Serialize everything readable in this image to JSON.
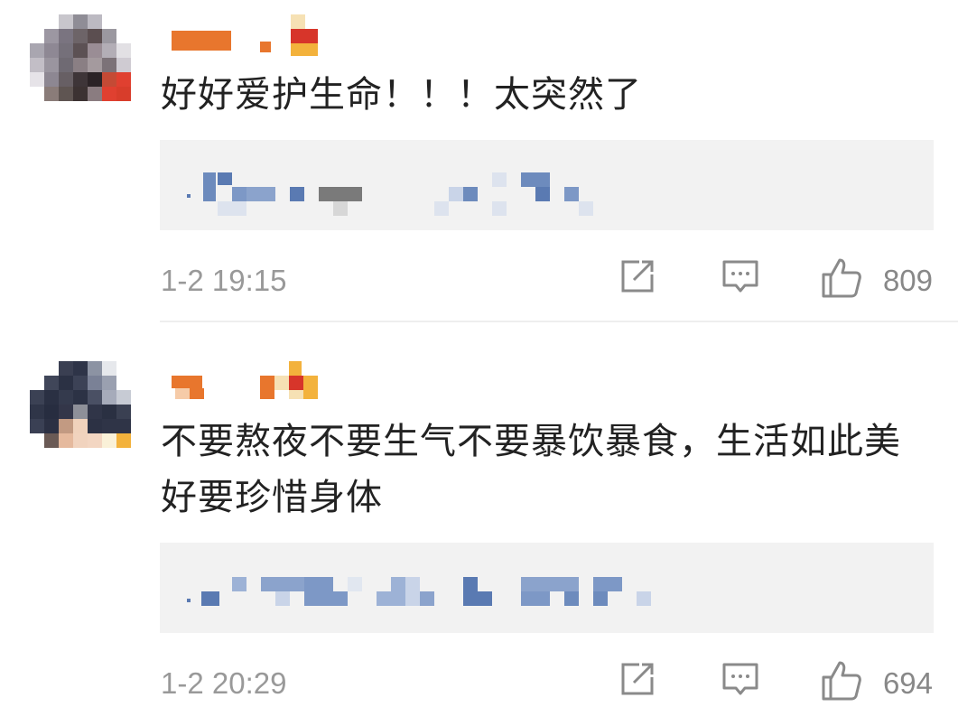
{
  "colors": {
    "text": "#222222",
    "meta": "#999999",
    "reply_bg": "#f2f2f2",
    "accent_orange": "#e8762d"
  },
  "comments": [
    {
      "text": "好好爱护生命！！！太突然了",
      "time": "1-2 19:15",
      "likes": "809",
      "actions": {
        "share_icon": "share-icon",
        "comment_icon": "comment-icon",
        "like_icon": "thumbs-up-icon"
      }
    },
    {
      "text": "不要熬夜不要生气不要暴饮暴食，生活如此美好要珍惜身体",
      "time": "1-2 20:29",
      "likes": "694",
      "actions": {
        "share_icon": "share-icon",
        "comment_icon": "comment-icon",
        "like_icon": "thumbs-up-icon"
      }
    }
  ]
}
